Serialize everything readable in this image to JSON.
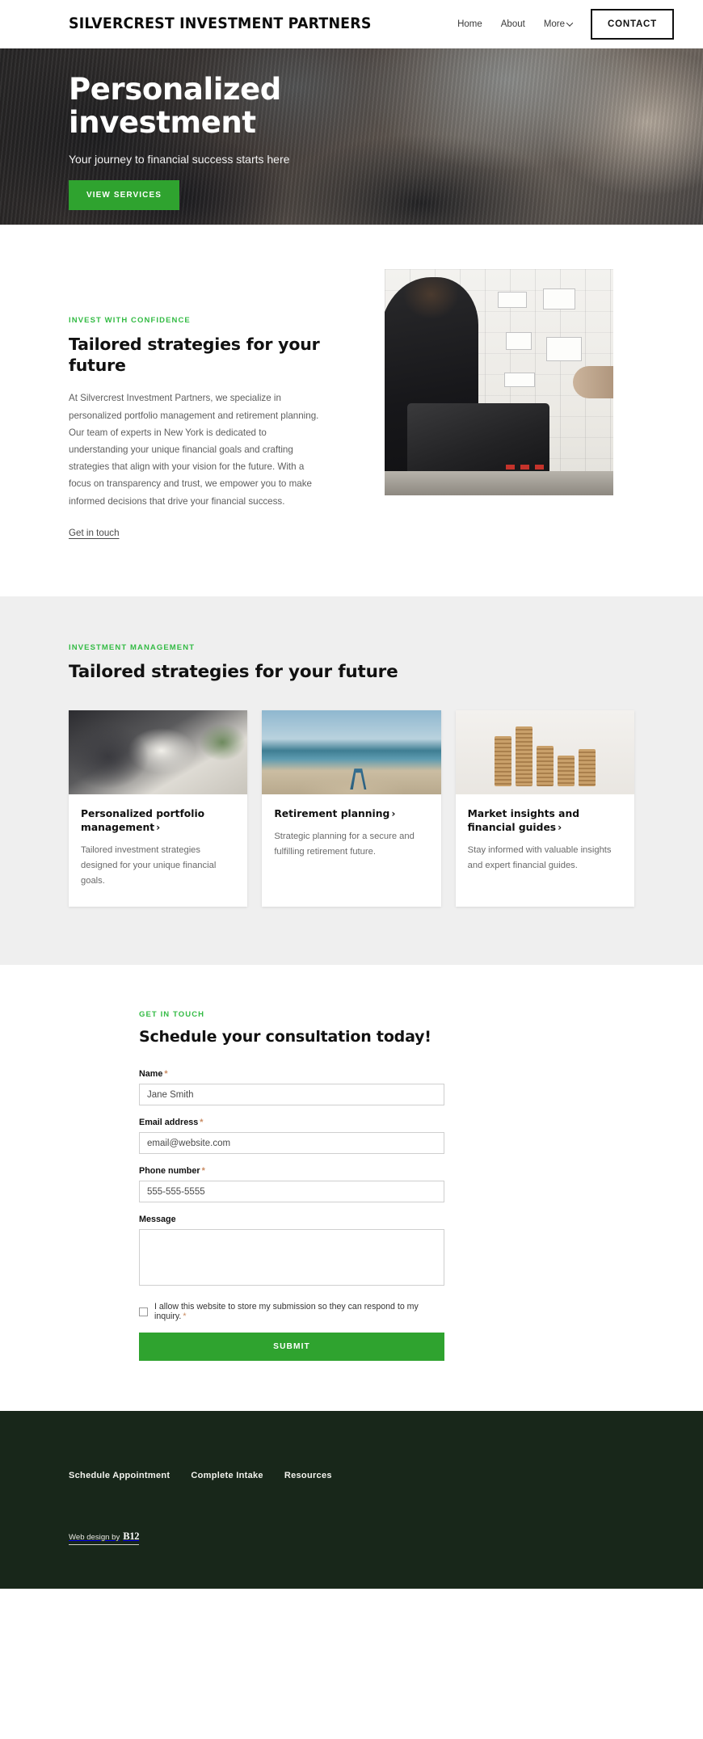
{
  "header": {
    "brand": "SILVERCREST INVESTMENT PARTNERS",
    "nav": [
      {
        "label": "Home"
      },
      {
        "label": "About"
      },
      {
        "label": "More"
      }
    ],
    "contact_label": "CONTACT"
  },
  "hero": {
    "title_line1": "Personalized",
    "title_line2": "investment",
    "subtitle": "Your journey to financial success starts here",
    "cta_label": "VIEW SERVICES",
    "cta_color": "#2fa32f"
  },
  "about": {
    "eyebrow": "INVEST WITH CONFIDENCE",
    "heading": "Tailored strategies for your future",
    "paragraph": "At Silvercrest Investment Partners, we specialize in personalized portfolio management and retirement planning. Our team of experts in New York is dedicated to understanding your unique financial goals and crafting strategies that align with your vision for the future. With a focus on transparency and trust, we empower you to make informed decisions that drive your financial success.",
    "link_label": "Get in touch"
  },
  "services": {
    "eyebrow": "INVESTMENT MANAGEMENT",
    "heading": "Tailored strategies for your future",
    "accent_color": "#33bb44",
    "cards": [
      {
        "title": "Personalized portfolio management",
        "arrow": "›",
        "description": "Tailored investment strategies designed for your unique financial goals."
      },
      {
        "title": "Retirement planning",
        "arrow": "›",
        "description": "Strategic planning for a secure and fulfilling retirement future."
      },
      {
        "title": "Market insights and financial guides",
        "arrow": "›",
        "description": "Stay informed with valuable insights and expert financial guides."
      }
    ]
  },
  "contact": {
    "eyebrow": "GET IN TOUCH",
    "heading": "Schedule your consultation today!",
    "fields": {
      "name": {
        "label": "Name",
        "required": "*",
        "value": "Jane Smith"
      },
      "email": {
        "label": "Email address",
        "required": "*",
        "value": "email@website.com"
      },
      "phone": {
        "label": "Phone number",
        "required": "*",
        "value": "555-555-5555"
      },
      "message": {
        "label": "Message",
        "value": ""
      }
    },
    "consent": "I allow this website to store my submission so they can respond to my inquiry.",
    "consent_required": "*",
    "submit_label": "SUBMIT"
  },
  "footer": {
    "links": [
      {
        "label": "Schedule Appointment"
      },
      {
        "label": "Complete Intake"
      },
      {
        "label": "Resources"
      }
    ],
    "credit_text": "Web design by",
    "credit_logo": "B12",
    "background_color": "#18271a"
  }
}
